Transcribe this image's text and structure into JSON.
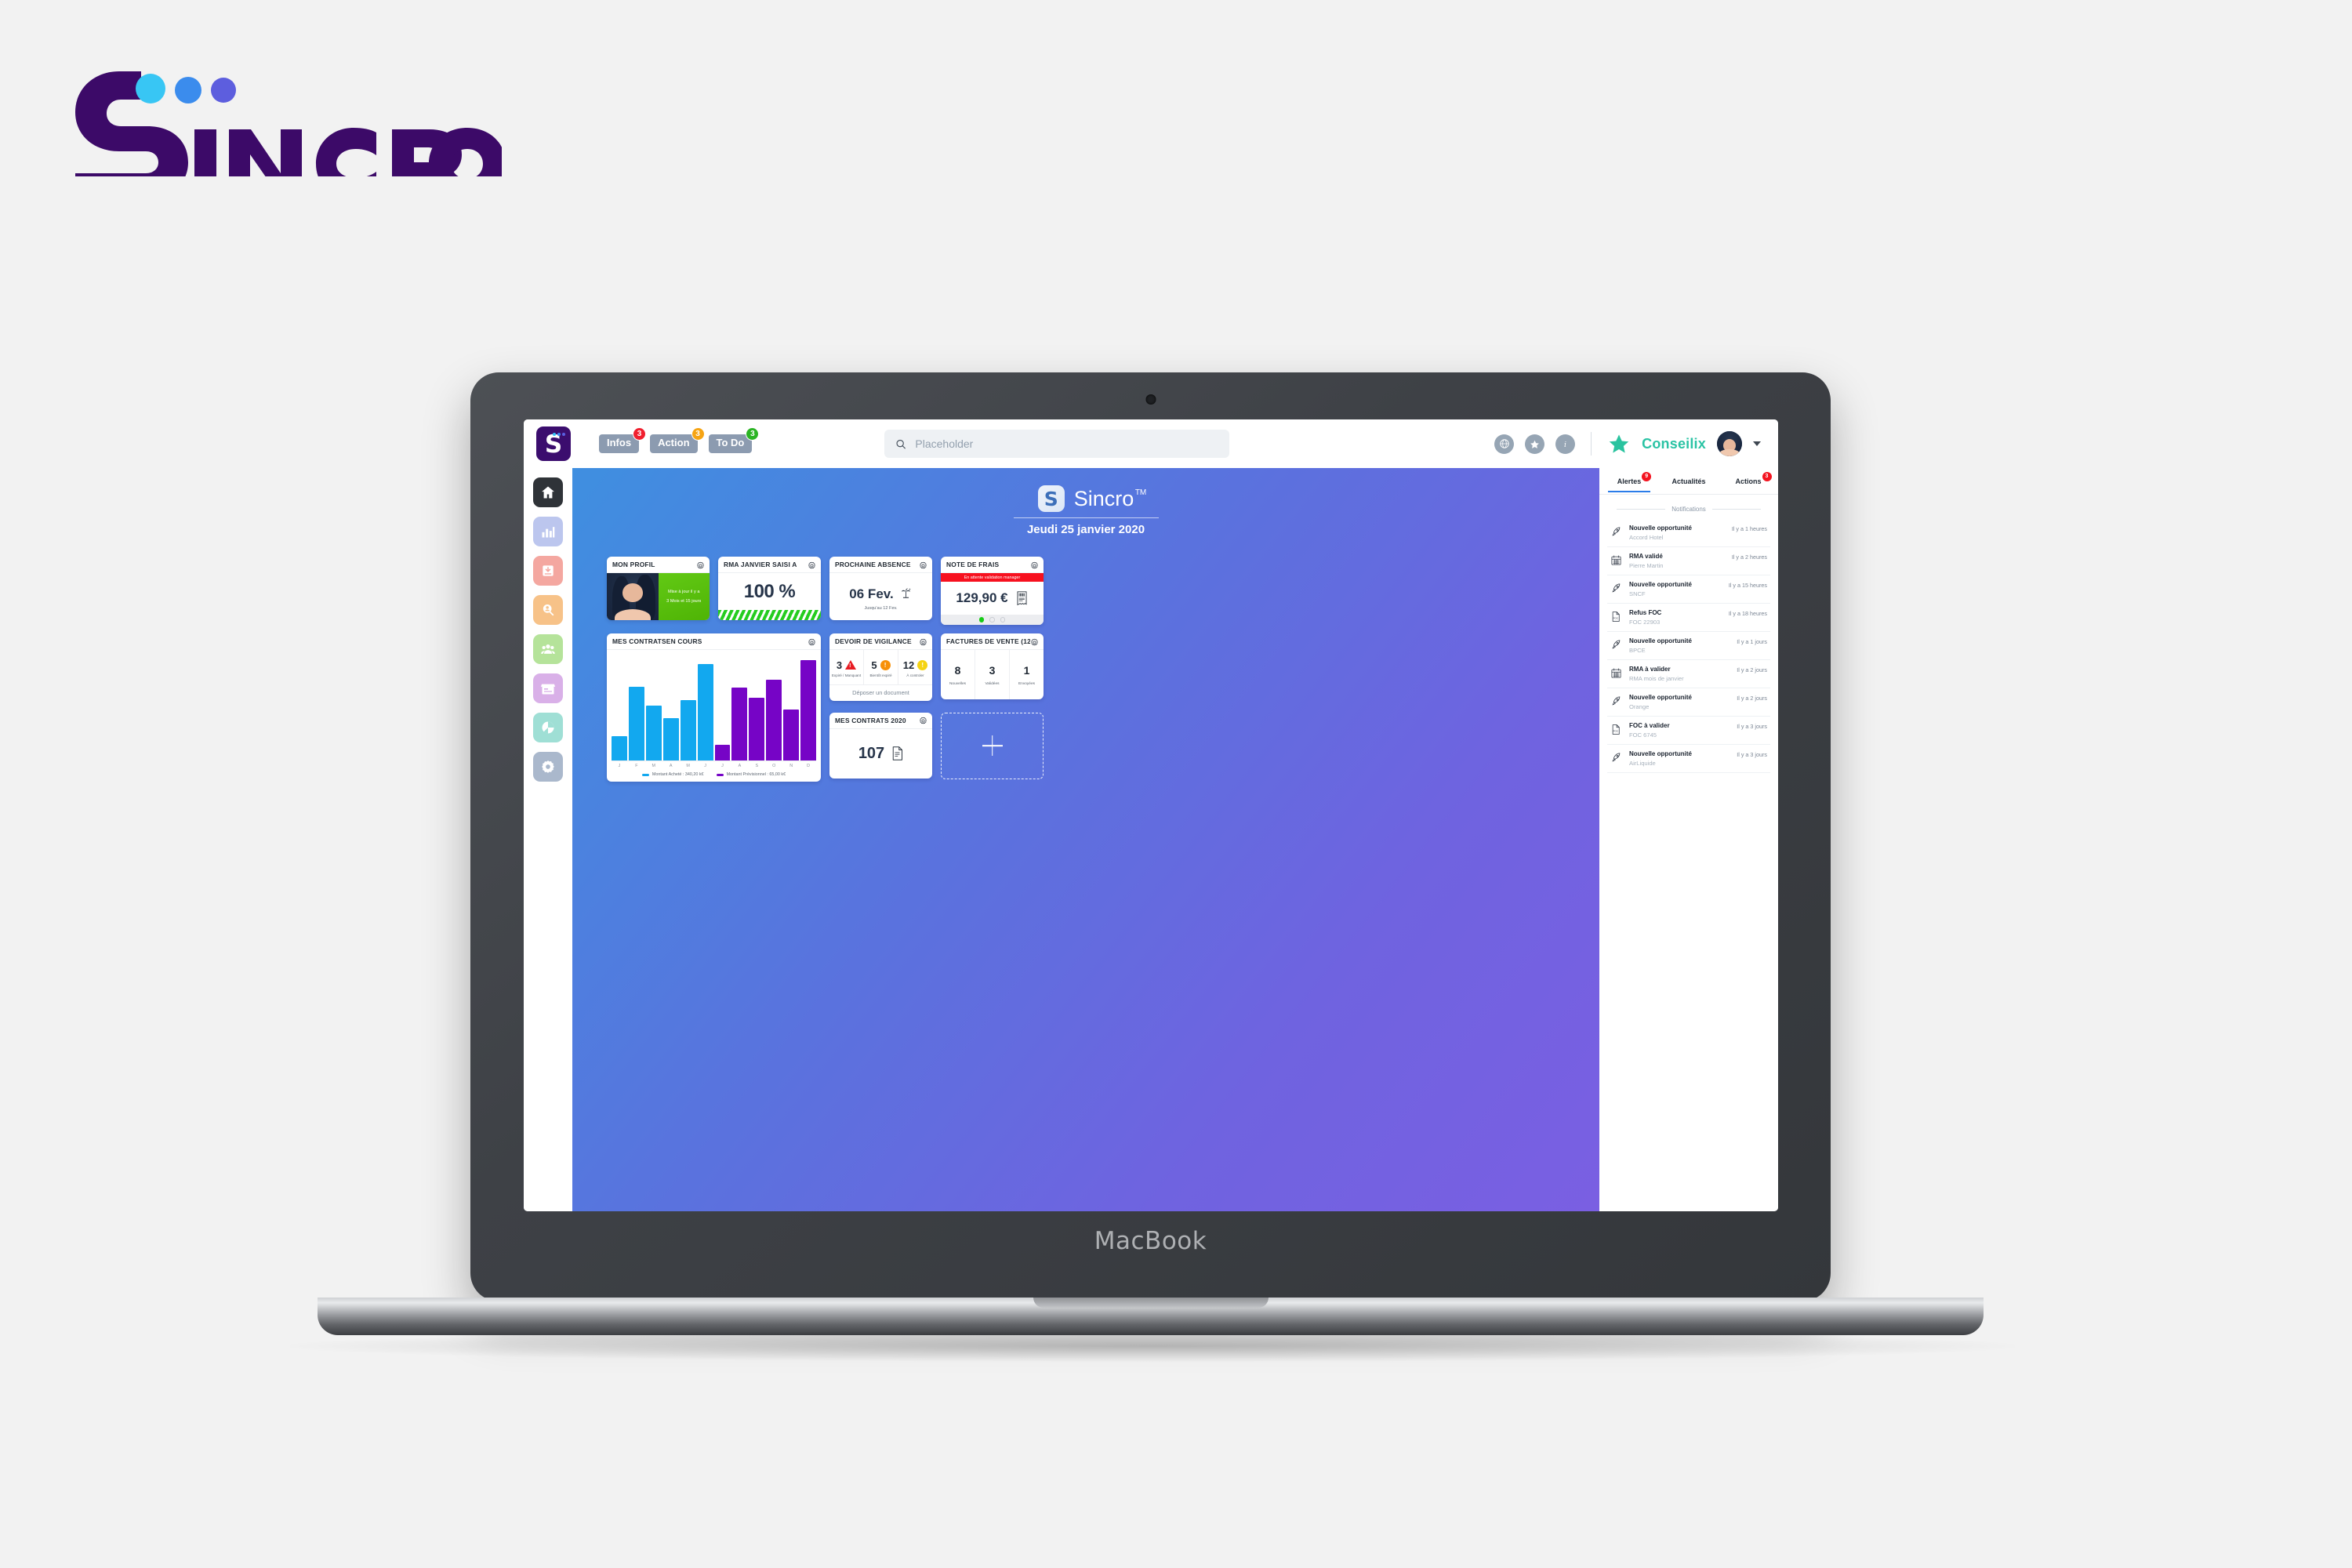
{
  "brand": {
    "name": "Sincro"
  },
  "device": {
    "label": "MacBook"
  },
  "topbar": {
    "logo_letter": "S",
    "pills": [
      {
        "label": "Infos",
        "badge": "3",
        "badge_color": "red"
      },
      {
        "label": "Action",
        "badge": "3",
        "badge_color": "orange"
      },
      {
        "label": "To Do",
        "badge": "3",
        "badge_color": "green"
      }
    ],
    "search_placeholder": "Placeholder",
    "icons": [
      "globe-icon",
      "star-icon",
      "info-icon"
    ],
    "tenant": "Conseilix"
  },
  "sidebar": {
    "items": [
      {
        "name": "home",
        "color": "#2f3338",
        "active": true
      },
      {
        "name": "reporting",
        "color": "#bcc6ee",
        "active": false
      },
      {
        "name": "purchase",
        "color": "#f4a7a0",
        "active": false
      },
      {
        "name": "prospect",
        "color": "#f7c288",
        "active": false
      },
      {
        "name": "teams",
        "color": "#b5e39a",
        "active": false
      },
      {
        "name": "store",
        "color": "#d9b0e8",
        "active": false
      },
      {
        "name": "analytics",
        "color": "#9fdfd5",
        "active": false
      },
      {
        "name": "settings",
        "color": "#aab8cc",
        "active": false
      }
    ]
  },
  "dashboard": {
    "app_name": "Sincro",
    "trademark": "TM",
    "logo_letter": "S",
    "date": "Jeudi 25 janvier 2020",
    "cards": {
      "profile": {
        "title": "MON PROFIL",
        "line1": "Mise à jour il y a",
        "line2": "3 Mois et 15 jours"
      },
      "rma": {
        "title": "RMA JANVIER SAISI A",
        "value": "100 %"
      },
      "absence": {
        "title": "PROCHAINE ABSENCE",
        "date": "06 Fev.",
        "sub": "Jusqu'au 12 Fev.",
        "icon": "palm-tree-icon"
      },
      "note_frais": {
        "title": "NOTE DE FRAIS",
        "banner": "En attente validation manager",
        "value": "129,90 €",
        "icon": "receipt-icon",
        "dots": 3,
        "active_dot": 0
      },
      "vigilance": {
        "title": "DEVOIR DE VIGILANCE",
        "columns": [
          {
            "value": "3",
            "label": "Expiré / Manquant",
            "icon": "warning-triangle-icon"
          },
          {
            "value": "5",
            "label": "Bientôt expiré",
            "icon": "exclamation-circle-orange-icon"
          },
          {
            "value": "12",
            "label": "À controler",
            "icon": "exclamation-circle-yellow-icon"
          }
        ],
        "footer": "Déposer un document"
      },
      "factures": {
        "title": "FACTURES DE VENTE (12)",
        "columns": [
          {
            "value": "8",
            "label": "Nouvelles"
          },
          {
            "value": "3",
            "label": "Validées"
          },
          {
            "value": "1",
            "label": "Envoyées"
          }
        ]
      },
      "contrats": {
        "title": "MES CONTRATS 2020",
        "value": "107",
        "icon": "document-icon"
      },
      "add_widget": {
        "icon": "plus-icon"
      }
    }
  },
  "chart_data": {
    "type": "bar",
    "title": "MES CONTRATSEN COURS",
    "categories": [
      "J",
      "F",
      "M",
      "A",
      "M",
      "J",
      "J",
      "A",
      "S",
      "O",
      "N",
      "D"
    ],
    "xlabel": "",
    "ylabel": "",
    "ylim": [
      0,
      100
    ],
    "grid": false,
    "legend_position": "bottom",
    "series": [
      {
        "name": "Montant Acheté",
        "color": "#12a8ef",
        "total_label": "340,20 k€",
        "legend": "Montant Acheté : 340,20 k€",
        "values": [
          23,
          70,
          52,
          40,
          57,
          91,
          null,
          null,
          null,
          null,
          null,
          null
        ]
      },
      {
        "name": "Montant Prévisionnel",
        "color": "#7604c6",
        "total_label": "65,00 k€",
        "legend": "Montant Prévisionnel : 65,00 k€",
        "values": [
          null,
          null,
          null,
          null,
          null,
          null,
          15,
          69,
          59,
          76,
          48,
          95
        ]
      }
    ]
  },
  "notifications": {
    "tabs": [
      {
        "label": "Alertes",
        "badge": "9",
        "active": true
      },
      {
        "label": "Actualités",
        "badge": "",
        "active": false
      },
      {
        "label": "Actions",
        "badge": "3",
        "active": false
      }
    ],
    "section_label": "Notifications",
    "items": [
      {
        "icon": "rocket-icon",
        "title": "Nouvelle opportunité",
        "sub": "Accord Hotel",
        "time": "Il y a 1 heures"
      },
      {
        "icon": "calendar-icon",
        "title": "RMA validé",
        "sub": "Pierre Martin",
        "time": "Il y a 2 heures"
      },
      {
        "icon": "rocket-icon",
        "title": "Nouvelle opportunité",
        "sub": "SNCF",
        "time": "Il y a 15 heures"
      },
      {
        "icon": "file-icon",
        "title": "Refus FOC",
        "sub": "FOC 22903",
        "time": "Il y a 18 heures"
      },
      {
        "icon": "rocket-icon",
        "title": "Nouvelle opportunité",
        "sub": "BPCE",
        "time": "Il y a 1 jours"
      },
      {
        "icon": "calendar-icon",
        "title": "RMA à valider",
        "sub": "RMA mois de janvier",
        "time": "Il y a 2 jours"
      },
      {
        "icon": "rocket-icon",
        "title": "Nouvelle opportunité",
        "sub": "Orange",
        "time": "Il y a 2 jours"
      },
      {
        "icon": "file-icon",
        "title": "FOC à valider",
        "sub": "FOC 6745",
        "time": "Il y a 3 jours"
      },
      {
        "icon": "rocket-icon",
        "title": "Nouvelle opportunité",
        "sub": "AirLiquide",
        "time": "Il y a 3 jours"
      }
    ]
  },
  "colors": {
    "brand_purple": "#3b0d6e",
    "accent_blue": "#12a8ef",
    "accent_violet": "#7604c6",
    "tenant_green": "#2ac3a4",
    "alert_red": "#f3131f"
  }
}
